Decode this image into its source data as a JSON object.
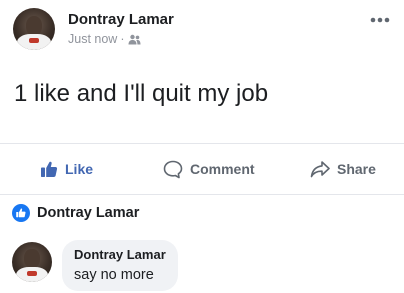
{
  "post": {
    "author": "Dontray Lamar",
    "timestamp": "Just now",
    "separator": "·",
    "audience_icon": "friends-icon",
    "menu_icon": "more-horizontal-icon",
    "text": "1 like and I'll quit my job"
  },
  "actions": {
    "like_label": "Like",
    "comment_label": "Comment",
    "share_label": "Share"
  },
  "reactions": {
    "icon": "like-reaction-icon",
    "liked_by": "Dontray Lamar"
  },
  "comment": {
    "author": "Dontray Lamar",
    "text": "say no more"
  },
  "colors": {
    "brand": "#4267b2",
    "text": "#1c1e21",
    "muted": "#90949c",
    "bubble": "#f0f2f5"
  }
}
